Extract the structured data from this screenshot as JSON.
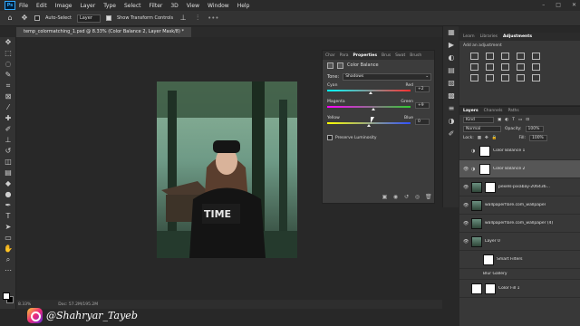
{
  "menubar": {
    "logo": "Ps",
    "items": [
      "File",
      "Edit",
      "Image",
      "Layer",
      "Type",
      "Select",
      "Filter",
      "3D",
      "View",
      "Window",
      "Help"
    ],
    "window_controls": [
      "–",
      "□",
      "✕"
    ]
  },
  "options": {
    "auto_select_label": "Auto-Select",
    "target_value": "Layer",
    "transform_label": "Show Transform Controls"
  },
  "document": {
    "tab_title": "temp_colormatching_1.psd @ 8.33% (Color Balance 2, Layer Mask/8) *",
    "zoom": "8.33%",
    "doc_size": "Doc: 57.2M/195.2M"
  },
  "properties": {
    "tabs": [
      "Char",
      "Para",
      "Properties",
      "Brus",
      "Swat",
      "Brush"
    ],
    "active_tab": "Properties",
    "title": "Color Balance",
    "tone_label": "Tone:",
    "tone_value": "Shadows",
    "sliders": [
      {
        "left": "Cyan",
        "right": "Red",
        "value": "+2",
        "level": 0.52
      },
      {
        "left": "Magenta",
        "right": "Green",
        "value": "+9",
        "level": 0.55
      },
      {
        "left": "Yellow",
        "right": "Blue",
        "value": "0",
        "level": 0.5
      }
    ],
    "preserve_label": "Preserve Luminosity"
  },
  "adjustments": {
    "tabs": [
      "Learn",
      "Libraries",
      "Adjustments"
    ],
    "active_tab": "Adjustments",
    "subtitle": "Add an adjustment"
  },
  "layers": {
    "tabs": [
      "Layers",
      "Channels",
      "Paths"
    ],
    "active_tab": "Layers",
    "kind_label": "Kind",
    "blend_mode": "Normal",
    "opacity_label": "Opacity:",
    "opacity_value": "100%",
    "lock_label": "Lock:",
    "fill_label": "Fill:",
    "fill_value": "100%",
    "items": [
      {
        "name": "Color Balance 1",
        "kind": "adjust",
        "visible": false,
        "selected": false
      },
      {
        "name": "Color Balance 2",
        "kind": "adjust",
        "visible": true,
        "selected": true
      },
      {
        "name": "pexels-pixabay-206436...",
        "kind": "photo",
        "visible": true,
        "selected": false
      },
      {
        "name": "wallpaperflare.com_wallpaper",
        "kind": "photo",
        "visible": true,
        "selected": false
      },
      {
        "name": "wallpaperflare.com_wallpaper (4)",
        "kind": "photo",
        "visible": true,
        "selected": false
      },
      {
        "name": "Layer 0",
        "kind": "photo",
        "visible": true,
        "selected": false
      },
      {
        "name": "Smart Filters",
        "kind": "filter",
        "visible": true,
        "selected": false
      },
      {
        "name": "Blur Gallery",
        "kind": "filter-item",
        "visible": true,
        "selected": false
      },
      {
        "name": "Color Fill 1",
        "kind": "adjust",
        "visible": false,
        "selected": false
      }
    ]
  },
  "watermark": {
    "text": "@Shahryar_Tayeb"
  },
  "colors": {
    "accent": "#31a8ff",
    "panel_bg": "#383838",
    "app_bg": "#282828"
  }
}
